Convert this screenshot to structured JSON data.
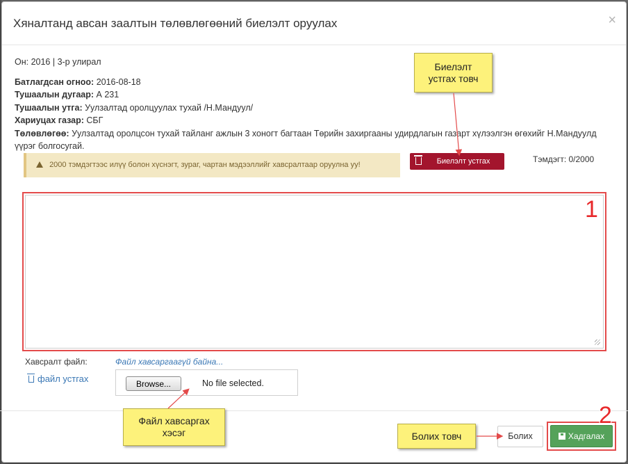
{
  "modal": {
    "title": "Хяналтанд авсан заалтын төлөвлөгөөний биелэлт оруулах",
    "close_symbol": "×"
  },
  "info": {
    "period": "Он: 2016 | 3-р улирал",
    "approved_label": "Батлагдсан огноо:",
    "approved_value": "2016-08-18",
    "decree_no_label": "Тушаалын дугаар:",
    "decree_no_value": "А 231",
    "decree_content_label": "Тушаалын утга:",
    "decree_content_value": "Уулзалтад оролцуулах тухай /Н.Мандуул/",
    "responsible_label": "Хариуцах газар:",
    "responsible_value": "СБГ",
    "plan_label": "Төлөвлөгөө:",
    "plan_value": "Уулзалтад оролцсон тухай тайланг ажлын 3 хоногт багтаан Төрийн захиргааны удирдлагын газарт хүлээлгэн өгөхийг Н.Мандуулд үүрэг болгосугай."
  },
  "warning_text": "2000 тэмдэгтээс илүү болон хүснэгт, зураг, чартан мэдээллийг хавсралтаар оруулна уу!",
  "delete_result_button": "Биелэлт устгах",
  "char_counter": "Тэмдэгт: 0/2000",
  "result_textarea": {
    "value": "",
    "placeholder": ""
  },
  "attachment": {
    "label": "Хавсралт файл:",
    "status": "Файл хавсаргаагүй байна...",
    "remove_link": "файл устгах",
    "browse_button": "Browse...",
    "no_file_text": "No file selected."
  },
  "footer": {
    "close_button": "Болих",
    "save_button": "Хадгалах"
  },
  "annotations": {
    "marker_1": "1",
    "marker_2": "2",
    "callout_delete": "Биелэлт\nустгах товч",
    "callout_file": "Файл хавсаргах\nхэсэг",
    "callout_close": "Болих товч"
  },
  "colors": {
    "danger": "#a3152d",
    "success": "#55a25a",
    "warning_bg": "#f3e8c4",
    "link": "#3b78b5",
    "highlight_border": "#e34a4a",
    "callout_bg": "#fdf27b"
  }
}
